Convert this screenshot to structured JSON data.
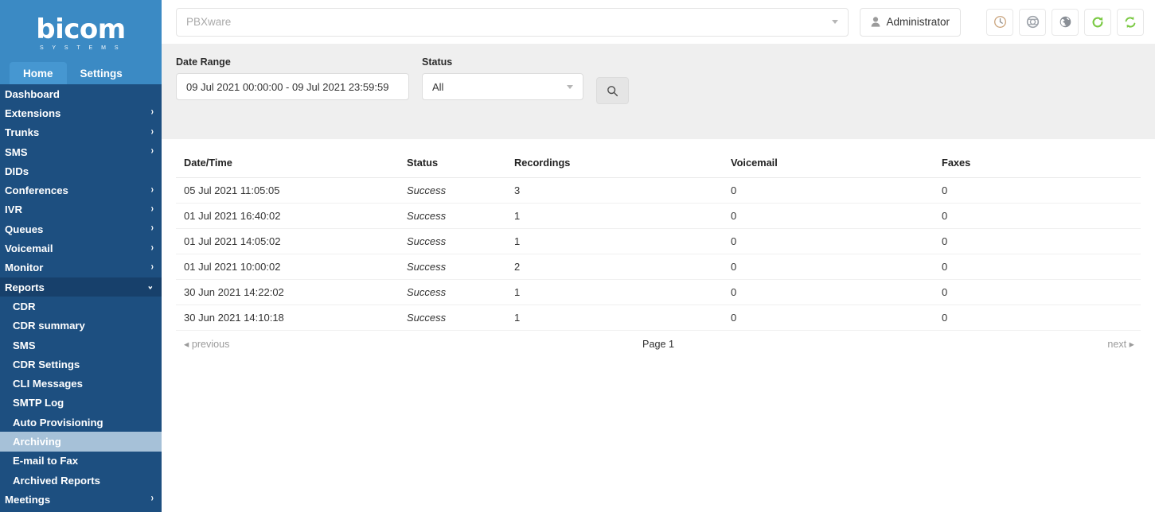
{
  "brand": {
    "name": "bicom",
    "tagline": "S Y S T E M S"
  },
  "tabs": [
    {
      "label": "Home",
      "active": true
    },
    {
      "label": "Settings",
      "active": false
    }
  ],
  "sidebar": {
    "items": [
      {
        "label": "Dashboard",
        "expandable": false
      },
      {
        "label": "Extensions",
        "expandable": true
      },
      {
        "label": "Trunks",
        "expandable": true
      },
      {
        "label": "SMS",
        "expandable": true
      },
      {
        "label": "DIDs",
        "expandable": false
      },
      {
        "label": "Conferences",
        "expandable": true
      },
      {
        "label": "IVR",
        "expandable": true
      },
      {
        "label": "Queues",
        "expandable": true
      },
      {
        "label": "Voicemail",
        "expandable": true
      },
      {
        "label": "Monitor",
        "expandable": true
      },
      {
        "label": "Reports",
        "expandable": true,
        "expanded": true
      }
    ],
    "reports_children": [
      {
        "label": "CDR",
        "selected": false
      },
      {
        "label": "CDR summary",
        "selected": false
      },
      {
        "label": "SMS",
        "selected": false
      },
      {
        "label": "CDR Settings",
        "selected": false
      },
      {
        "label": "CLI Messages",
        "selected": false
      },
      {
        "label": "SMTP Log",
        "selected": false
      },
      {
        "label": "Auto Provisioning",
        "selected": false
      },
      {
        "label": "Archiving",
        "selected": true
      },
      {
        "label": "E-mail to Fax",
        "selected": false
      },
      {
        "label": "Archived Reports",
        "selected": false
      }
    ],
    "trailing": [
      {
        "label": "Meetings",
        "expandable": true
      }
    ],
    "chevron_right": "›",
    "chevron_down": "⌄",
    "colors": {
      "bg": "#1d4f80",
      "header_bg": "#3b8ac4",
      "active_item_bg": "#17406b",
      "selected_sub_bg": "#a6c1d8"
    }
  },
  "topbar": {
    "pbx_selector_placeholder": "PBXware",
    "admin_label": "Administrator",
    "icons": [
      {
        "name": "clock-icon"
      },
      {
        "name": "lifebuoy-icon"
      },
      {
        "name": "globe-icon"
      },
      {
        "name": "reload-icon"
      },
      {
        "name": "sync-icon"
      }
    ],
    "accent_green": "#7ac943"
  },
  "filters": {
    "date_range_label": "Date Range",
    "date_range_value": "09 Jul 2021 00:00:00 - 09 Jul 2021 23:59:59",
    "status_label": "Status",
    "status_value": "All",
    "search_icon": "search-icon"
  },
  "table": {
    "columns": [
      "Date/Time",
      "Status",
      "Recordings",
      "Voicemail",
      "Faxes"
    ],
    "rows": [
      {
        "datetime": "05 Jul 2021 11:05:05",
        "status": "Success",
        "recordings": "3",
        "voicemail": "0",
        "faxes": "0"
      },
      {
        "datetime": "01 Jul 2021 16:40:02",
        "status": "Success",
        "recordings": "1",
        "voicemail": "0",
        "faxes": "0"
      },
      {
        "datetime": "01 Jul 2021 14:05:02",
        "status": "Success",
        "recordings": "1",
        "voicemail": "0",
        "faxes": "0"
      },
      {
        "datetime": "01 Jul 2021 10:00:02",
        "status": "Success",
        "recordings": "2",
        "voicemail": "0",
        "faxes": "0"
      },
      {
        "datetime": "30 Jun 2021 14:22:02",
        "status": "Success",
        "recordings": "1",
        "voicemail": "0",
        "faxes": "0"
      },
      {
        "datetime": "30 Jun 2021 14:10:18",
        "status": "Success",
        "recordings": "1",
        "voicemail": "0",
        "faxes": "0"
      }
    ],
    "status_color": "#2aa11f"
  },
  "pagination": {
    "previous": "◂ previous",
    "page": "Page 1",
    "next": "next ▸"
  }
}
